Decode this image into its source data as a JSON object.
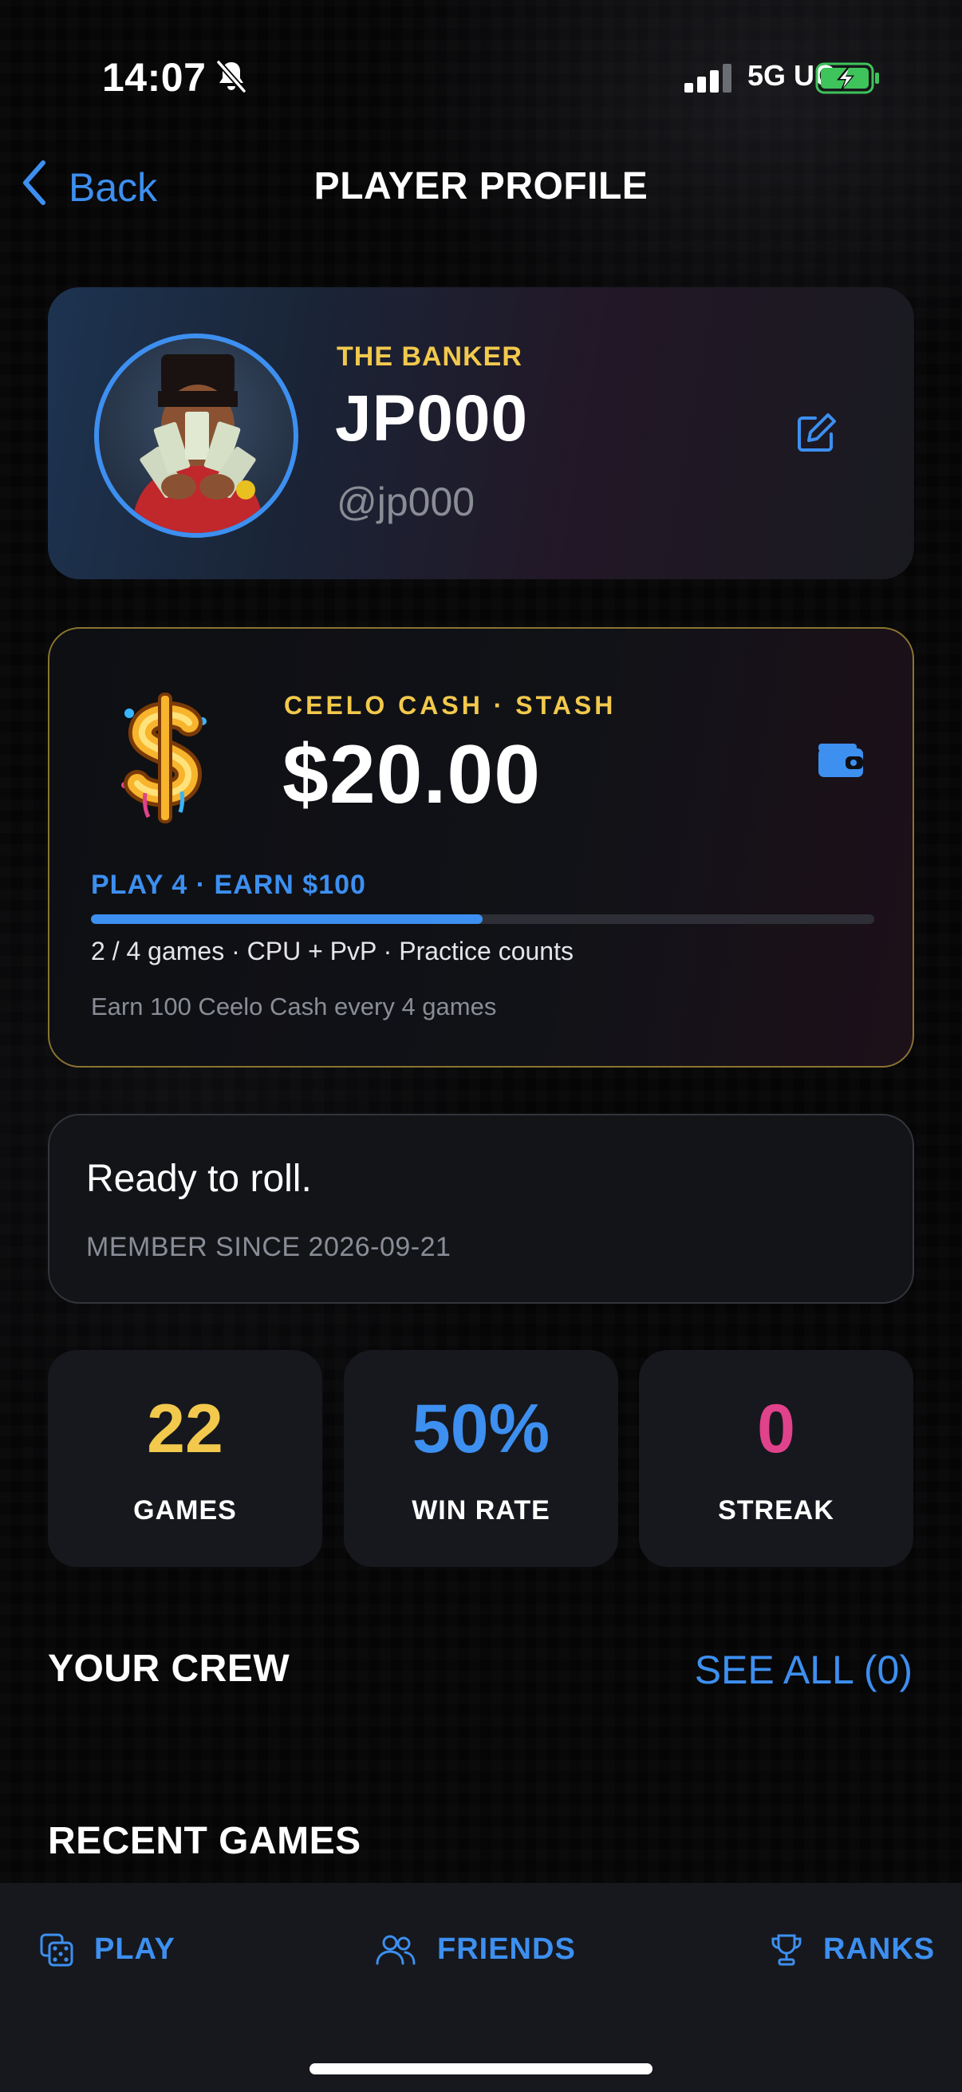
{
  "status_bar": {
    "time": "14:07",
    "network": "5G UC"
  },
  "nav": {
    "back_label": "Back",
    "title": "PLAYER PROFILE"
  },
  "profile": {
    "title": "THE BANKER",
    "name": "JP000",
    "handle": "@jp000"
  },
  "cash": {
    "label": "CEELO CASH · STASH",
    "amount": "$20.00",
    "goal_label": "PLAY 4 · EARN $100",
    "progress_fraction": 0.5,
    "progress_text": "2 / 4 games · CPU + PvP · Practice counts",
    "note": "Earn 100 Ceelo Cash every 4 games"
  },
  "bio": {
    "text": "Ready to roll.",
    "member_since": "MEMBER SINCE 2026-09-21"
  },
  "stats": [
    {
      "value": "22",
      "label": "GAMES",
      "color": "#f2c94c"
    },
    {
      "value": "50%",
      "label": "WIN RATE",
      "color": "#3d8ff0"
    },
    {
      "value": "0",
      "label": "STREAK",
      "color": "#e0428c"
    }
  ],
  "crew": {
    "title": "YOUR CREW",
    "see_all": "SEE ALL (0)"
  },
  "recent": {
    "title": "RECENT GAMES"
  },
  "tabs": [
    {
      "label": "PLAY",
      "icon": "dice-icon"
    },
    {
      "label": "FRIENDS",
      "icon": "users-icon"
    },
    {
      "label": "RANKS",
      "icon": "trophy-icon"
    }
  ],
  "colors": {
    "accent": "#3d8ff0",
    "gold": "#f2c94c",
    "pink": "#e0428c"
  }
}
